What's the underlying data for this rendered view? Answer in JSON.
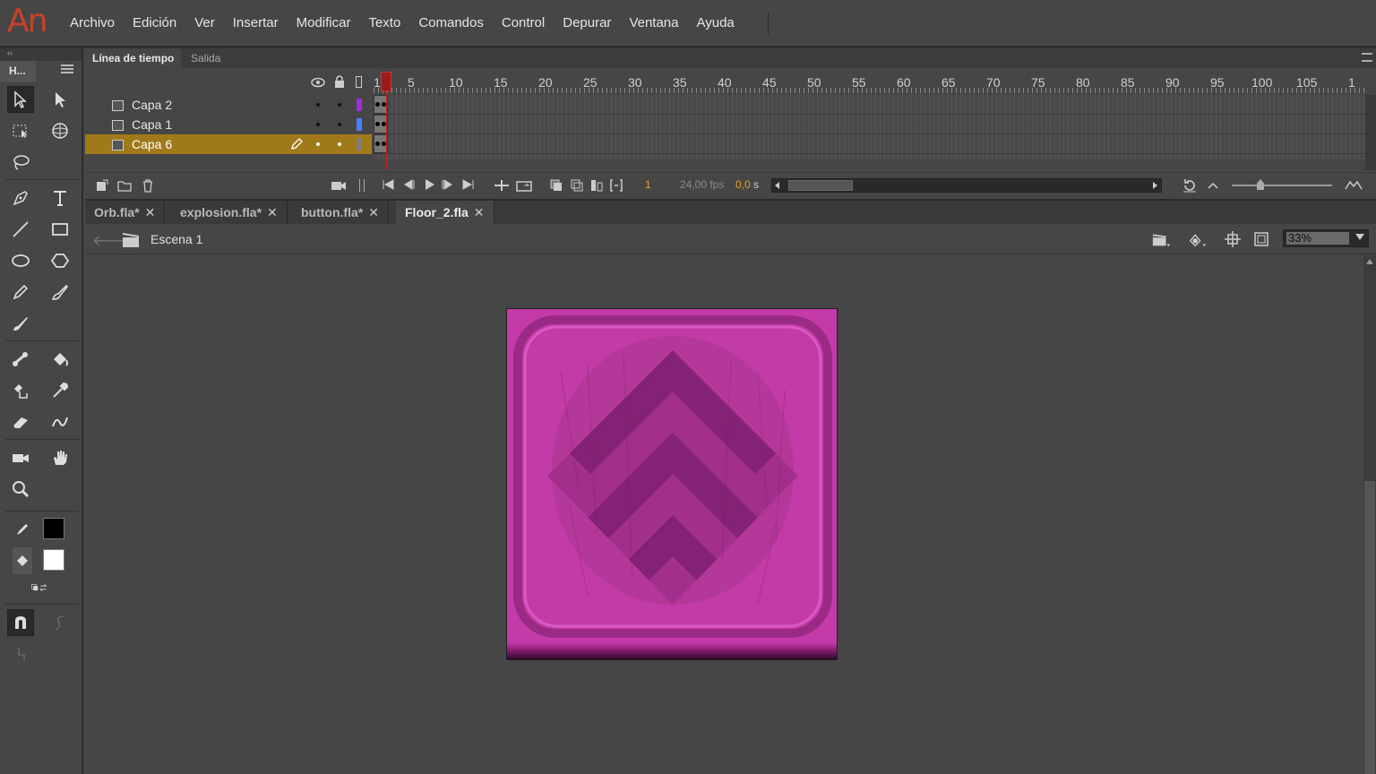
{
  "app": {
    "logo": "An"
  },
  "menu": [
    "Archivo",
    "Edición",
    "Ver",
    "Insertar",
    "Modificar",
    "Texto",
    "Comandos",
    "Control",
    "Depurar",
    "Ventana",
    "Ayuda"
  ],
  "toolbox": {
    "tab_label": "H...",
    "collapse_glyph": "‹‹"
  },
  "timeline": {
    "tabs": [
      "Línea de tiempo",
      "Salida"
    ],
    "frame_numbers": [
      "1",
      "5",
      "10",
      "15",
      "20",
      "25",
      "30",
      "35",
      "40",
      "45",
      "50",
      "55",
      "60",
      "65",
      "70",
      "75",
      "80",
      "85",
      "90",
      "95",
      "100",
      "105",
      "1"
    ],
    "layers": [
      {
        "name": "Capa 2",
        "color": "#9b30d9",
        "active": false
      },
      {
        "name": "Capa 1",
        "color": "#4a7dff",
        "active": false
      },
      {
        "name": "Capa 6",
        "color": "#808080",
        "active": true
      }
    ],
    "current_frame": "1",
    "fps": "24,00 fps",
    "elapsed_value": "0,0",
    "elapsed_unit": "s"
  },
  "documents": [
    {
      "name": "Orb.fla*",
      "active": false
    },
    {
      "name": "explosion.fla*",
      "active": false
    },
    {
      "name": "button.fla*",
      "active": false
    },
    {
      "name": "Floor_2.fla",
      "active": true
    }
  ],
  "editbar": {
    "scene": "Escena 1",
    "zoom": "33%"
  },
  "colors": {
    "stroke": "#000000",
    "fill": "#ffffff",
    "stage_bg": "#464646",
    "artwork": "#c33aa8",
    "active_layer": "#a07a1a",
    "playhead": "#9a1b1b"
  }
}
